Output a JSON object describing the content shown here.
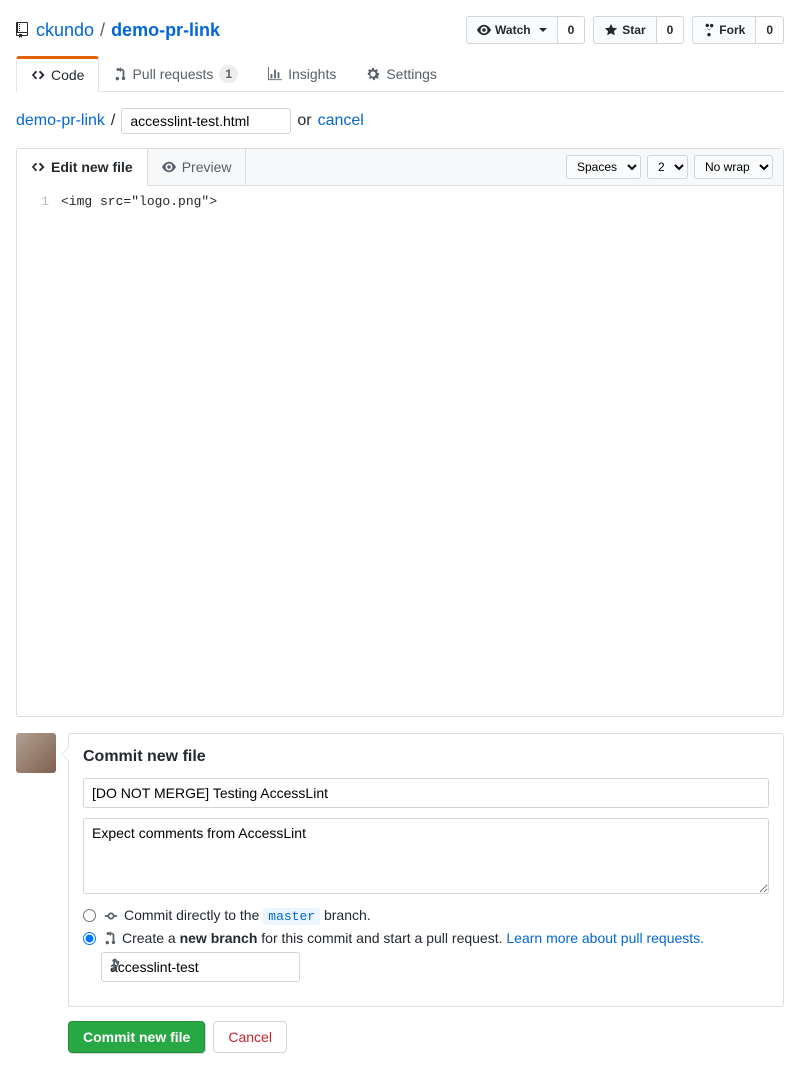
{
  "repo": {
    "owner": "ckundo",
    "name": "demo-pr-link"
  },
  "actions": {
    "watch": {
      "label": "Watch",
      "count": "0"
    },
    "star": {
      "label": "Star",
      "count": "0"
    },
    "fork": {
      "label": "Fork",
      "count": "0"
    }
  },
  "tabs": {
    "code": "Code",
    "prs": "Pull requests",
    "prs_count": "1",
    "insights": "Insights",
    "settings": "Settings"
  },
  "breadcrumb": {
    "root": "demo-pr-link",
    "filename": "accesslint-test.html",
    "or": "or",
    "cancel": "cancel"
  },
  "editor": {
    "tabs": {
      "edit": "Edit new file",
      "preview": "Preview"
    },
    "options": {
      "indent": "Spaces",
      "size": "2",
      "wrap": "No wrap"
    },
    "line_number": "1",
    "content": "<img src=\"logo.png\">"
  },
  "commit": {
    "title": "Commit new file",
    "summary": "[DO NOT MERGE] Testing AccessLint",
    "description": "Expect comments from AccessLint",
    "radio1_pre": "Commit directly to the ",
    "radio1_branch": "master",
    "radio1_post": " branch.",
    "radio2_pre": "Create a ",
    "radio2_bold": "new branch",
    "radio2_post": " for this commit and start a pull request. ",
    "radio2_link": "Learn more about pull requests.",
    "branch_value": "accesslint-test",
    "submit": "Commit new file",
    "cancel": "Cancel"
  }
}
